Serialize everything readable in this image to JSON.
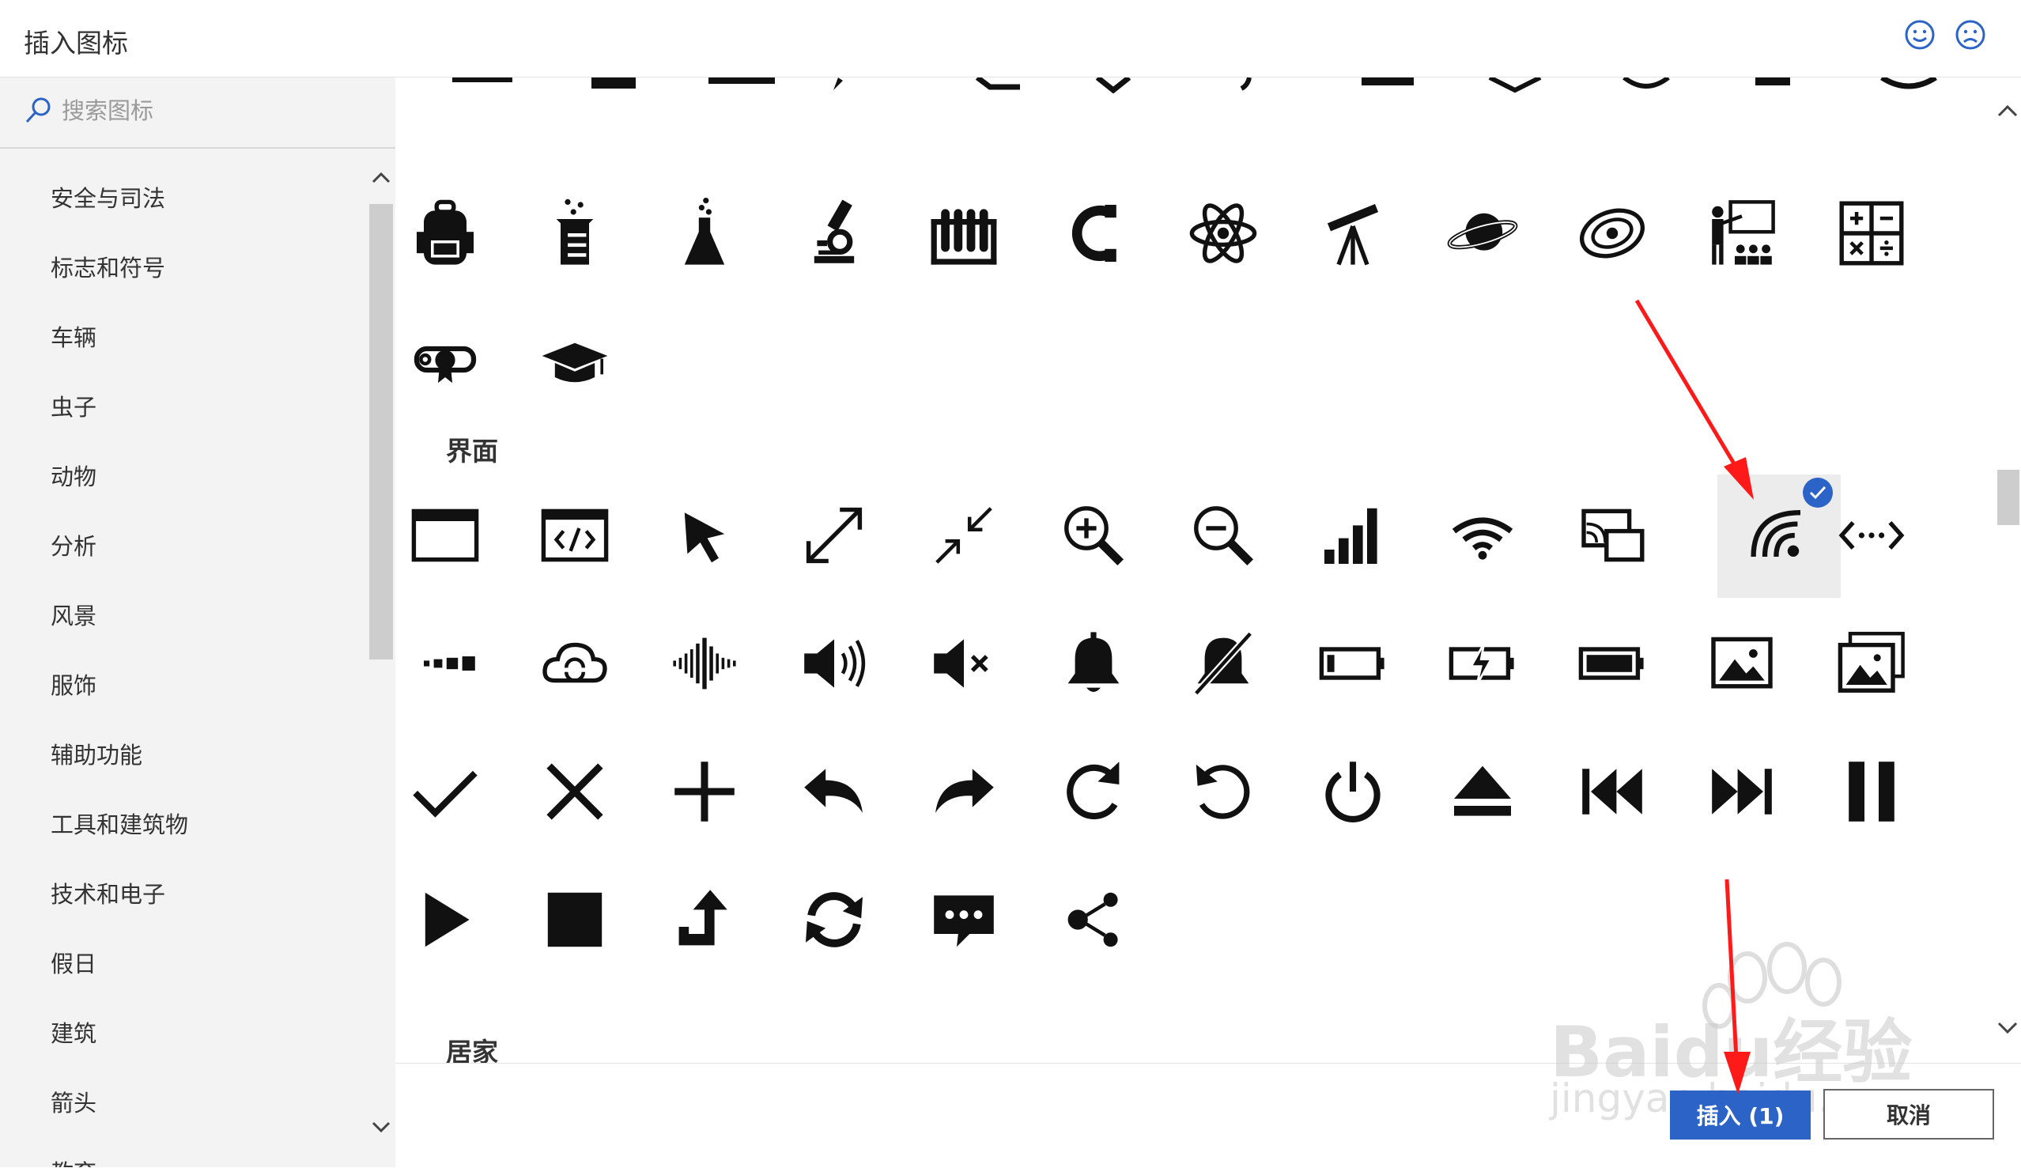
{
  "window": {
    "title": "插入图标"
  },
  "header": {
    "feedback_icons": [
      "smile-icon",
      "frown-icon"
    ]
  },
  "search": {
    "placeholder": "搜索图标"
  },
  "categories": [
    "安全与司法",
    "标志和符号",
    "车辆",
    "虫子",
    "动物",
    "分析",
    "风景",
    "服饰",
    "辅助功能",
    "工具和建筑物",
    "技术和电子",
    "假日",
    "建筑",
    "箭头",
    "教育"
  ],
  "sections": {
    "education_row": [
      "backpack-icon",
      "beaker-icon",
      "flask-icon",
      "microscope-icon",
      "test-tubes-icon",
      "magnet-icon",
      "atom-icon",
      "telescope-icon",
      "planet-icon",
      "galaxy-icon",
      "classroom-icon",
      "calculator-icon",
      "diploma-icon",
      "graduation-cap-icon"
    ],
    "interface": {
      "title": "界面",
      "icons": [
        "browser-window-icon",
        "code-window-icon",
        "cursor-icon",
        "expand-icon",
        "compress-icon",
        "zoom-in-icon",
        "zoom-out-icon",
        "signal-bars-icon",
        "wifi-icon",
        "screen-cast-icon",
        "cast-icon",
        "code-arrows-icon",
        "progress-icon",
        "cloud-sync-icon",
        "audio-wave-icon",
        "volume-icon",
        "mute-icon",
        "bell-icon",
        "bell-off-icon",
        "battery-low-icon",
        "battery-charging-icon",
        "battery-full-icon",
        "image-icon",
        "images-icon",
        "checkmark-icon",
        "close-icon",
        "plus-icon",
        "undo-icon",
        "redo-icon",
        "refresh-icon",
        "rotate-icon",
        "power-icon",
        "eject-icon",
        "skip-back-icon",
        "skip-forward-icon",
        "pause-icon",
        "play-icon",
        "stop-icon",
        "turn-up-icon",
        "sync-icon",
        "chat-icon",
        "share-icon"
      ],
      "selected": "cast-icon"
    },
    "next_section_title": "居家"
  },
  "footer": {
    "insert_label": "插入 (1)",
    "cancel_label": "取消"
  },
  "watermark": {
    "text": "Baidu经验",
    "sub": "jingyan.baidu.com"
  },
  "colors": {
    "accent": "#2b64c6",
    "arrow": "#ff1a1a",
    "pane_bg": "#f3f3f3"
  }
}
